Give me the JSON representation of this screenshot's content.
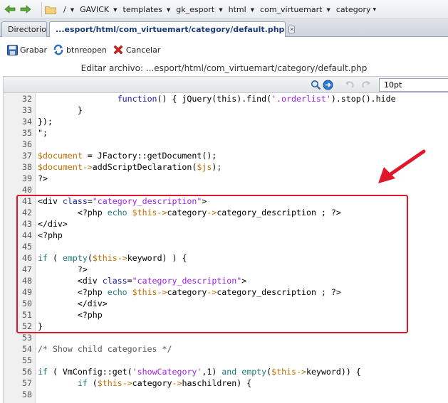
{
  "breadcrumb": {
    "root_label": "/",
    "items": [
      "GAVICK",
      "templates",
      "gk_esport",
      "html",
      "com_virtuemart",
      "category"
    ]
  },
  "tabs": [
    {
      "label": "Directorio"
    },
    {
      "label": "...esport/html/com_virtuemart/category/default.php",
      "close": "✕"
    }
  ],
  "toolbar": {
    "save_label": "Grabar",
    "reopen_label": "btnreopen",
    "cancel_label": "Cancelar"
  },
  "file_title": "Editar archivo: ...esport/html/com_virtuemart/category/default.php",
  "editor": {
    "font_size": "10pt"
  },
  "code_lines": [
    {
      "n": "32",
      "text": "                function() { jQuery(this).find('.orderlist').stop().hide"
    },
    {
      "n": "33",
      "text": "        }"
    },
    {
      "n": "34",
      "text": "});"
    },
    {
      "n": "35",
      "text": "\";"
    },
    {
      "n": "36",
      "text": ""
    },
    {
      "n": "37",
      "text": "$document = JFactory::getDocument();"
    },
    {
      "n": "38",
      "text": "$document->addScriptDeclaration($js);"
    },
    {
      "n": "39",
      "text": "?>"
    },
    {
      "n": "40",
      "text": ""
    },
    {
      "n": "41",
      "text": "<div class=\"category_description\">"
    },
    {
      "n": "42",
      "text": "        <?php echo $this->category->category_description ; ?>"
    },
    {
      "n": "43",
      "text": "</div>"
    },
    {
      "n": "44",
      "text": "<?php"
    },
    {
      "n": "45",
      "text": ""
    },
    {
      "n": "46",
      "text": "if ( empty($this->keyword) ) {"
    },
    {
      "n": "47",
      "text": "        ?>"
    },
    {
      "n": "48",
      "text": "        <div class=\"category_description\">"
    },
    {
      "n": "49",
      "text": "        <?php echo $this->category->category_description ; ?>"
    },
    {
      "n": "50",
      "text": "        </div>"
    },
    {
      "n": "51",
      "text": "        <?php"
    },
    {
      "n": "52",
      "text": "}"
    },
    {
      "n": "53",
      "text": ""
    },
    {
      "n": "54",
      "text": "/* Show child categories */"
    },
    {
      "n": "55",
      "text": ""
    },
    {
      "n": "56",
      "text": "if ( VmConfig::get('showCategory',1) and empty($this->keyword)) {"
    },
    {
      "n": "57",
      "text": "        if ($this->category->haschildren) {"
    },
    {
      "n": "58",
      "text": ""
    }
  ],
  "colors": {
    "highlight_border": "#e0162b",
    "string": "#a020f0",
    "variable": "#bf6f00",
    "keyword": "#1f7a7a",
    "function": "#1a1aa6"
  }
}
